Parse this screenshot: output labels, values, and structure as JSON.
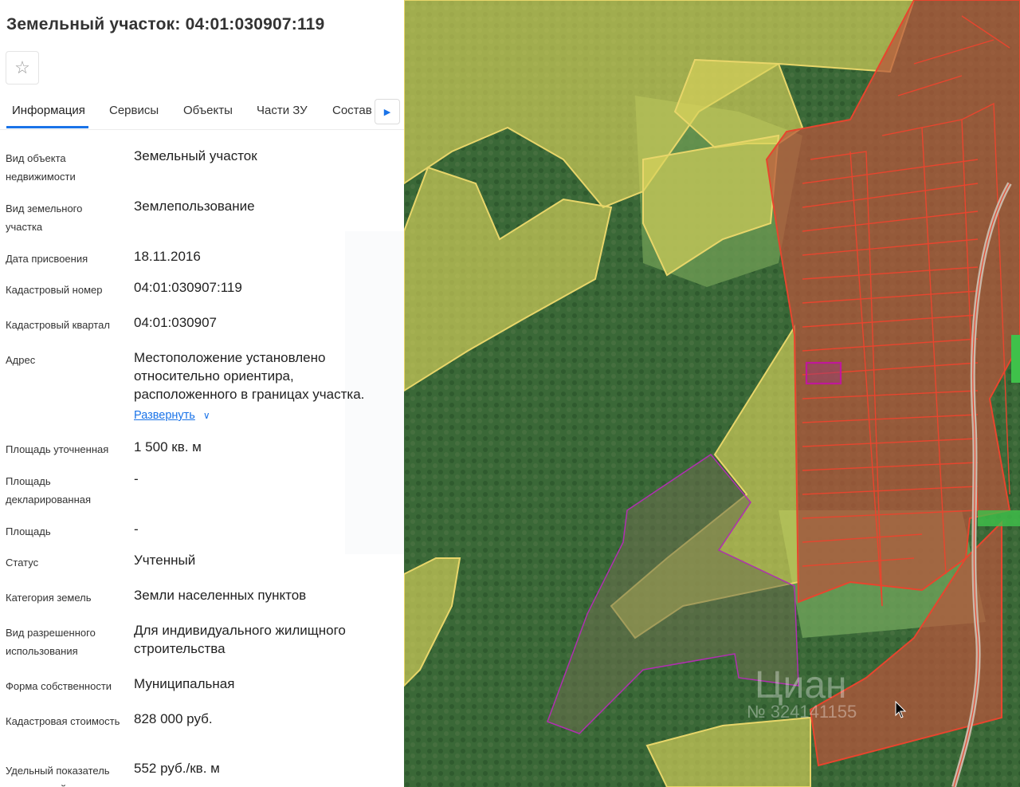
{
  "header": {
    "title": "Земельный участок: 04:01:030907:119",
    "favorite_icon": "star-outline-icon"
  },
  "tabs": [
    {
      "label": "Информация",
      "active": true
    },
    {
      "label": "Сервисы",
      "active": false
    },
    {
      "label": "Объекты",
      "active": false
    },
    {
      "label": "Части ЗУ",
      "active": false
    },
    {
      "label": "Состав",
      "active": false
    }
  ],
  "tabs_next_icon": "caret-right-icon",
  "fields": [
    {
      "label": "Вид объекта недвижимости",
      "value": "Земельный участок"
    },
    {
      "label": "Вид земельного участка",
      "value": "Землепользование"
    },
    {
      "label": "Дата присвоения",
      "value": "18.11.2016"
    },
    {
      "label": "Кадастровый номер",
      "value": "04:01:030907:119"
    },
    {
      "label": "Кадастровый квартал",
      "value": "04:01:030907"
    },
    {
      "label": "Адрес",
      "value": "Местоположение установлено относительно ориентира, расположенного в границах участка.",
      "expand_label": "Развернуть"
    },
    {
      "label": "Площадь уточненная",
      "value": "1 500 кв. м"
    },
    {
      "label": "Площадь декларированная",
      "value": "-"
    },
    {
      "label": "Площадь",
      "value": "-"
    },
    {
      "label": "Статус",
      "value": "Учтенный"
    },
    {
      "label": "Категория земель",
      "value": "Земли населенных пунктов"
    },
    {
      "label": "Вид разрешенного использования",
      "value": "Для индивидуального жилищного строительства"
    },
    {
      "label": "Форма собственности",
      "value": "Муниципальная"
    },
    {
      "label": "Кадастровая стоимость",
      "value": "828 000 руб."
    },
    {
      "label": "Удельный показатель кадастровой",
      "value": "552 руб./кв. м"
    }
  ],
  "map": {
    "watermark": "Циан",
    "watermark_id": "№ 324141155",
    "cursor_icon": "mouse-pointer-icon",
    "colors": {
      "forest": "#3d6a3a",
      "field_light": "#7aa35a",
      "yellow_fill": "#d9d25a",
      "yellow_stroke": "#e8d66a",
      "red_fill": "#b8543c",
      "red_stroke": "#e8452e",
      "purple_stroke": "#b02fb0",
      "selected": "#c0189a"
    }
  }
}
